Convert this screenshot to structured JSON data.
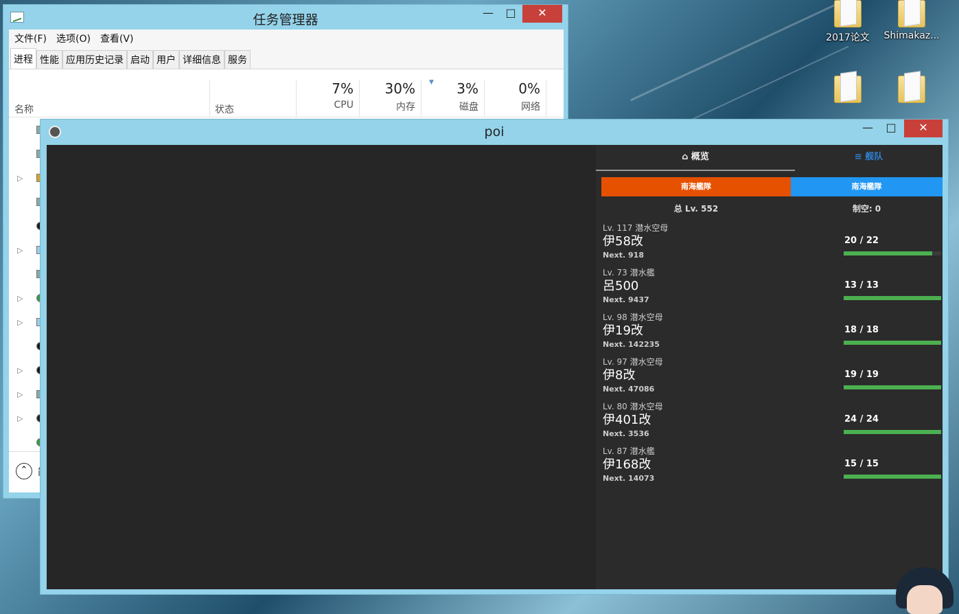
{
  "desktop": {
    "icons": [
      {
        "label": "2017论文"
      },
      {
        "label": "Shimakaz..."
      },
      {
        "label": ""
      },
      {
        "label": ""
      }
    ]
  },
  "task_manager": {
    "title": "任务管理器",
    "menu": [
      "文件(F)",
      "选项(O)",
      "查看(V)"
    ],
    "tabs": [
      "进程",
      "性能",
      "应用历史记录",
      "启动",
      "用户",
      "详细信息",
      "服务"
    ],
    "active_tab": "进程",
    "columns": {
      "name": "名称",
      "status": "状态",
      "cpu": {
        "pct": "7%",
        "label": "CPU"
      },
      "memory": {
        "pct": "30%",
        "label": "内存"
      },
      "disk": {
        "pct": "3%",
        "label": "磁盘"
      },
      "network": {
        "pct": "0%",
        "label": "网络"
      }
    },
    "footer_text": "简"
  },
  "poi": {
    "title": "poi",
    "nav": {
      "overview": "概览",
      "fleet": "舰队"
    },
    "fleets": [
      "南海艦隊",
      "南海艦隊"
    ],
    "total_lv": "总 Lv. 552",
    "air_control": "制空: 0",
    "colors": {
      "fleet_active": "#e65100",
      "fleet_inactive": "#2196f3",
      "hp_full": "#4caf50",
      "nav_fleet": "#2f7fd1"
    },
    "ships": [
      {
        "lv": "Lv. 117  潜水空母",
        "name": "伊58改",
        "next": "Next. 918",
        "hp": "20 / 22",
        "hp_ratio": 0.909
      },
      {
        "lv": "Lv. 73  潜水艦",
        "name": "呂500",
        "next": "Next. 9437",
        "hp": "13 / 13",
        "hp_ratio": 1.0
      },
      {
        "lv": "Lv. 98  潜水空母",
        "name": "伊19改",
        "next": "Next. 142235",
        "hp": "18 / 18",
        "hp_ratio": 1.0
      },
      {
        "lv": "Lv. 97  潜水空母",
        "name": "伊8改",
        "next": "Next. 47086",
        "hp": "19 / 19",
        "hp_ratio": 1.0
      },
      {
        "lv": "Lv. 80  潜水空母",
        "name": "伊401改",
        "next": "Next. 3536",
        "hp": "24 / 24",
        "hp_ratio": 1.0
      },
      {
        "lv": "Lv. 87  潜水艦",
        "name": "伊168改",
        "next": "Next. 14073",
        "hp": "15 / 15",
        "hp_ratio": 1.0
      }
    ]
  }
}
